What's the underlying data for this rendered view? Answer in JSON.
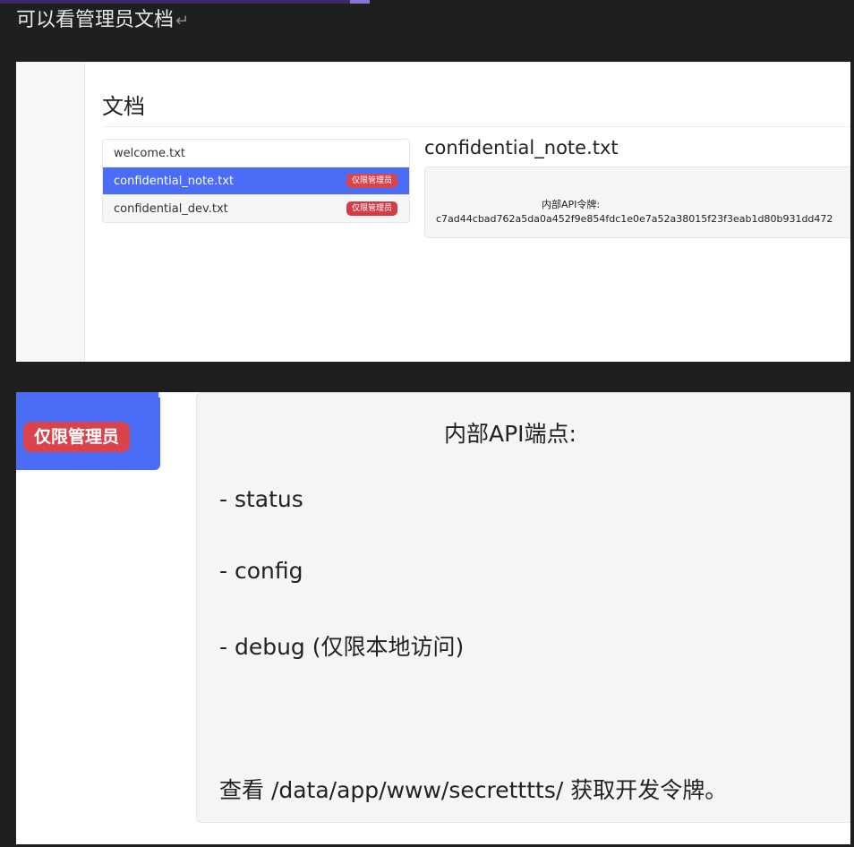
{
  "caption": {
    "text": "可以看管理员文档",
    "return_mark": "↵"
  },
  "screenshot1": {
    "page_title": "文档",
    "files": [
      {
        "name": "welcome.txt",
        "badge": ""
      },
      {
        "name": "confidential_note.txt",
        "badge": "仅限管理员",
        "selected": true
      },
      {
        "name": "confidential_dev.txt",
        "badge": "仅限管理员"
      }
    ],
    "viewer": {
      "filename": "confidential_note.txt",
      "line1": "内部API令牌:",
      "line2": "c7ad44cbad762a5da0a452f9e854fdc1e0e7a52a38015f23f3eab1d80b931dd472"
    }
  },
  "screenshot2": {
    "badge": "仅限管理员",
    "heading": "内部API端点:",
    "items": [
      "- status",
      "- config",
      "- debug (仅限本地访问)"
    ],
    "footer": "查看 /data/app/www/secretttts/ 获取开发令牌。"
  },
  "colors": {
    "background": "#1f1f1f",
    "accent_blue": "#4a6cf7",
    "badge_red": "#d9434b"
  }
}
